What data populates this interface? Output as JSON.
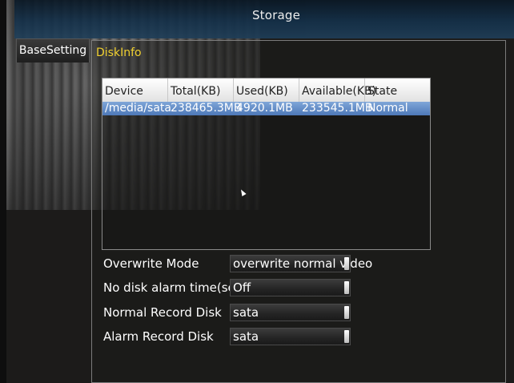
{
  "window": {
    "title": "Storage"
  },
  "tabs": {
    "base_setting": "BaseSetting",
    "disk_info": "DiskInfo"
  },
  "table": {
    "columns": [
      "Device",
      "Total(KB)",
      "Used(KB)",
      "Available(KB)",
      "State"
    ],
    "rows": [
      {
        "device": "/media/sata",
        "total": "238465.3MB",
        "used": "4920.1MB",
        "available": "233545.1MB",
        "state": "Normal"
      }
    ]
  },
  "form": {
    "overwrite_mode": {
      "label": "Overwrite Mode",
      "value": "overwrite normal video"
    },
    "no_disk_alarm": {
      "label": "No disk alarm time(seconds)",
      "value": "Off"
    },
    "normal_record_disk": {
      "label": "Normal Record Disk",
      "value": "sata"
    },
    "alarm_record_disk": {
      "label": "Alarm Record Disk",
      "value": "sata"
    }
  },
  "colors": {
    "title_bar": "#143049",
    "tab_active_text": "#f0d030",
    "row_selected": "#5b86c4",
    "header_bg": "#f2f2f2"
  }
}
